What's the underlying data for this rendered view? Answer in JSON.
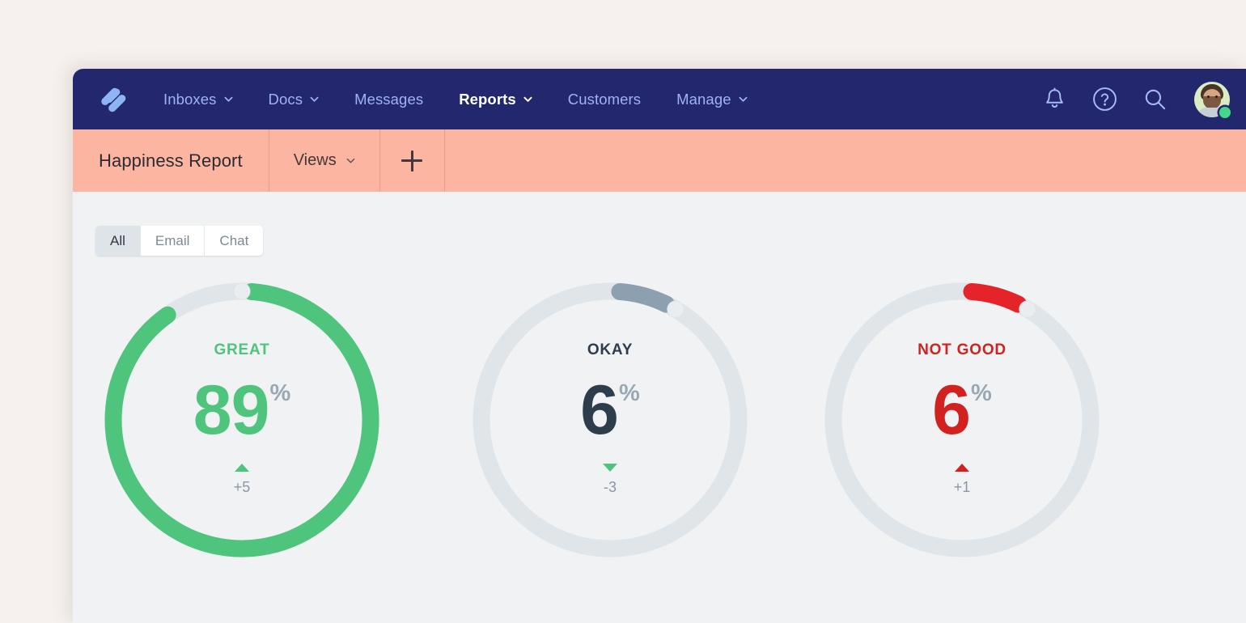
{
  "colors": {
    "canvas": "#f6f1ee",
    "navbar": "#23276e",
    "navlink": "#9fb3f2",
    "subheader": "#fcb5a0",
    "content_bg": "#f0f2f4",
    "track": "#dfe5e8",
    "knob": "#e9edef",
    "great": "#4ec47d",
    "okay": "#8ca0b0",
    "not_good": "#e5242a",
    "okay_text": "#2e3d4b",
    "percent_gray": "#9aa8b4",
    "delta_gray": "#8b98a4",
    "status_dot": "#43d787"
  },
  "topnav": {
    "logo_name": "help-scout-logo",
    "links": [
      {
        "label": "Inboxes",
        "has_chevron": true,
        "active": false
      },
      {
        "label": "Docs",
        "has_chevron": true,
        "active": false
      },
      {
        "label": "Messages",
        "has_chevron": false,
        "active": false
      },
      {
        "label": "Reports",
        "has_chevron": true,
        "active": true
      },
      {
        "label": "Customers",
        "has_chevron": false,
        "active": false
      },
      {
        "label": "Manage",
        "has_chevron": true,
        "active": false
      }
    ],
    "icons": [
      {
        "name": "notifications-bell-icon"
      },
      {
        "name": "help-question-icon"
      },
      {
        "name": "search-icon"
      }
    ],
    "avatar": {
      "name": "user-avatar",
      "status": "online"
    }
  },
  "subheader": {
    "title": "Happiness Report",
    "views_label": "Views",
    "add_label": "+"
  },
  "filters": {
    "tabs": [
      {
        "label": "All",
        "active": true
      },
      {
        "label": "Email",
        "active": false
      },
      {
        "label": "Chat",
        "active": false
      }
    ]
  },
  "chart_data": {
    "type": "pie",
    "title": "Happiness Report",
    "subtype": "radial-gauge-donuts",
    "unit": "%",
    "axis_range": [
      0,
      100
    ],
    "categories": [
      "GREAT",
      "OKAY",
      "NOT GOOD"
    ],
    "values": [
      89,
      6,
      6
    ],
    "deltas": [
      "+5",
      "-3",
      "+1"
    ],
    "gauges": [
      {
        "label": "GREAT",
        "value": 89,
        "percent_symbol": "%",
        "delta": "+5",
        "delta_direction": "up",
        "delta_icon": "triangle-up-icon",
        "arc_color": "#4ec47d",
        "label_color": "#4ec47d",
        "value_color": "#4ec47d",
        "delta_color": "#4ec47d"
      },
      {
        "label": "OKAY",
        "value": 6,
        "percent_symbol": "%",
        "delta": "-3",
        "delta_direction": "down",
        "delta_icon": "triangle-down-icon",
        "arc_color": "#8ca0b0",
        "label_color": "#2e3d4b",
        "value_color": "#2e3d4b",
        "delta_color": "#4ec47d"
      },
      {
        "label": "NOT GOOD",
        "value": 6,
        "percent_symbol": "%",
        "delta": "+1",
        "delta_direction": "up",
        "delta_icon": "triangle-up-icon",
        "arc_color": "#e5242a",
        "label_color": "#d2221f",
        "value_color": "#d2221f",
        "delta_color": "#d2221f"
      }
    ],
    "legend": [],
    "grid": false
  }
}
